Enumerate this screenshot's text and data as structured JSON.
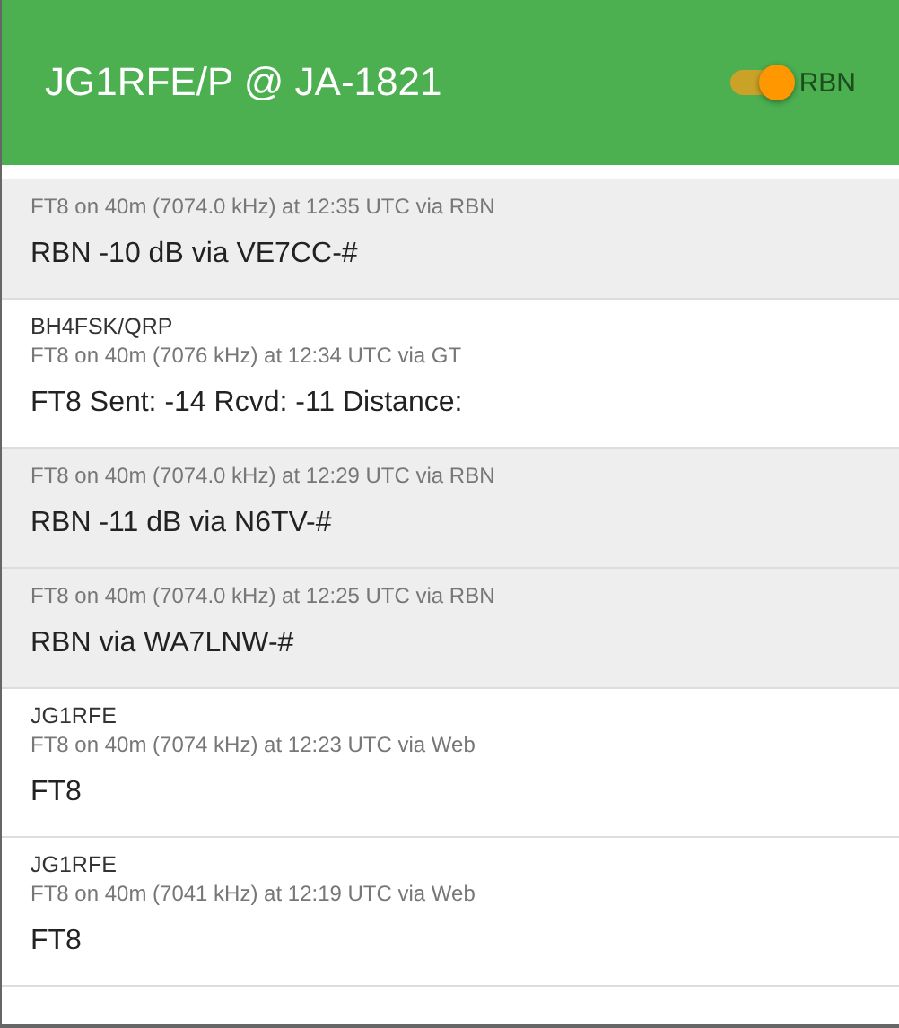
{
  "header": {
    "title": "JG1RFE/P @ JA-1821",
    "toggle": {
      "label": "RBN",
      "on": true
    }
  },
  "spots": [
    {
      "kind": "rbn",
      "meta": "FT8 on 40m (7074.0 kHz) at 12:35 UTC via RBN",
      "message": "RBN -10 dB via VE7CC-#"
    },
    {
      "kind": "spot",
      "caller": "BH4FSK/QRP",
      "meta": "FT8 on 40m (7076 kHz) at 12:34 UTC via GT",
      "message": "FT8 Sent: -14 Rcvd: -11 Distance:"
    },
    {
      "kind": "rbn",
      "meta": "FT8 on 40m (7074.0 kHz) at 12:29 UTC via RBN",
      "message": "RBN -11 dB via N6TV-#"
    },
    {
      "kind": "rbn",
      "meta": "FT8 on 40m (7074.0 kHz) at 12:25 UTC via RBN",
      "message": "RBN via WA7LNW-#"
    },
    {
      "kind": "spot",
      "caller": "JG1RFE",
      "meta": "FT8 on 40m (7074 kHz) at 12:23 UTC via Web",
      "message": "FT8"
    },
    {
      "kind": "spot",
      "caller": "JG1RFE",
      "meta": "FT8 on 40m (7041 kHz) at 12:19 UTC via Web",
      "message": "FT8"
    }
  ]
}
